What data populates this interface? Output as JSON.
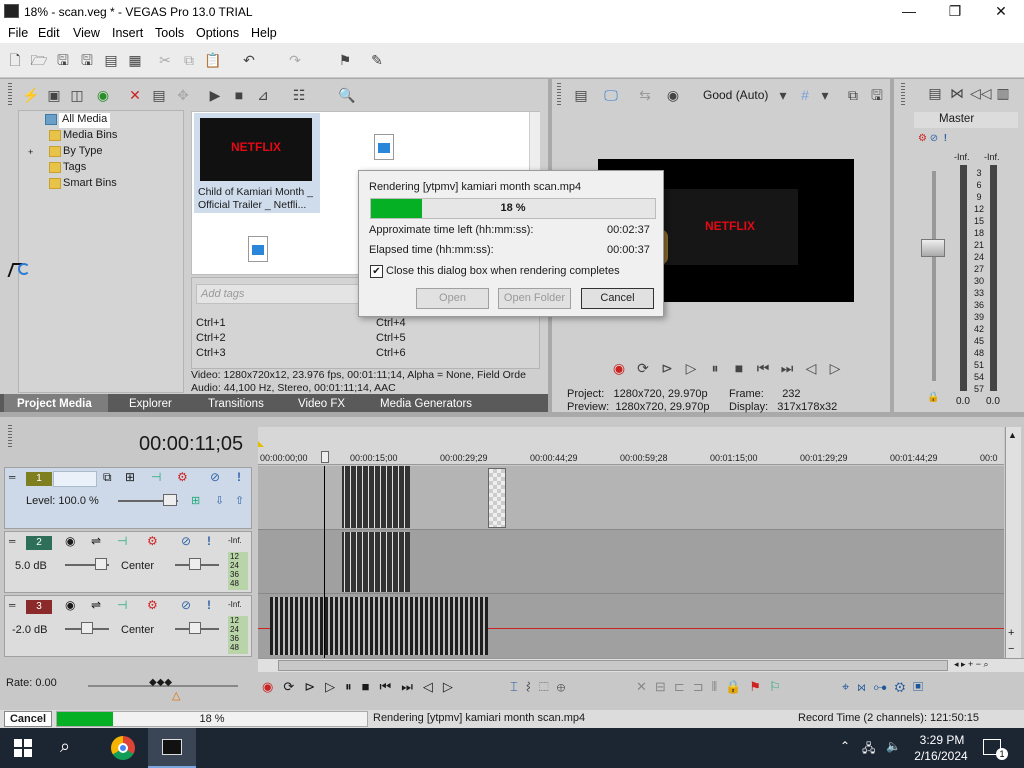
{
  "window": {
    "title": "18% - scan.veg * - VEGAS Pro 13.0 TRIAL",
    "minimize": "—",
    "maximize": "❐",
    "close": "✕"
  },
  "menu": [
    "File",
    "Edit",
    "View",
    "Insert",
    "Tools",
    "Options",
    "Help"
  ],
  "explorer": {
    "tree": [
      "All Media",
      "Media Bins",
      "By Type",
      "Tags",
      "Smart Bins"
    ],
    "expander": "+",
    "media": {
      "thumb_text": "NETFLIX",
      "name_line1": "Child of Kamiari Month _",
      "name_line2": "Official Trailer _ Netfli..."
    },
    "tags_placeholder": "Add tags",
    "shortcuts_left": [
      "Ctrl+1",
      "Ctrl+2",
      "Ctrl+3"
    ],
    "shortcuts_right": [
      "Ctrl+4",
      "Ctrl+5",
      "Ctrl+6"
    ],
    "info_video": "Video: 1280x720x12, 23.976 fps, 00:01:11;14, Alpha = None, Field Orde",
    "info_audio": "Audio: 44,100 Hz, Stereo, 00:01:11;14, AAC",
    "tabs": [
      "Project Media",
      "Explorer",
      "Transitions",
      "Video FX",
      "Media Generators"
    ]
  },
  "preview": {
    "quality": "Good (Auto)",
    "screen_text": "NETFLIX",
    "project_label": "Project:",
    "project_value": "1280x720, 29.970p",
    "preview_label": "Preview:",
    "preview_value": "1280x720, 29.970p",
    "frame_label": "Frame:",
    "frame_value": "232",
    "display_label": "Display:",
    "display_value": "317x178x32"
  },
  "master": {
    "title": "Master",
    "inf_left": "-Inf.",
    "inf_right": "-Inf.",
    "scale": [
      "3",
      "6",
      "9",
      "12",
      "15",
      "18",
      "21",
      "24",
      "27",
      "30",
      "33",
      "36",
      "39",
      "42",
      "45",
      "48",
      "51",
      "54",
      "57"
    ],
    "val_left": "0.0",
    "val_right": "0.0"
  },
  "dialog": {
    "title": "Rendering [ytpmv] kamiari month scan.mp4",
    "progress_label": "18 %",
    "progress_fraction": 0.18,
    "time_left_label": "Approximate time left (hh:mm:ss):",
    "time_left_value": "00:02:37",
    "elapsed_label": "Elapsed time (hh:mm:ss):",
    "elapsed_value": "00:00:37",
    "checkbox_label": "Close this dialog box when rendering completes",
    "checked": "✔",
    "open_btn": "Open",
    "open_folder_btn": "Open Folder",
    "cancel_btn": "Cancel"
  },
  "timeline": {
    "timecode": "00:00:11;05",
    "ruler": [
      "00:00:00;00",
      "00:00:15;00",
      "00:00:29;29",
      "00:00:44;29",
      "00:00:59;28",
      "00:01:15;00",
      "00:01:29;29",
      "00:01:44;29",
      "00:0"
    ],
    "track1": {
      "number": "1",
      "level": "Level: 100.0 %"
    },
    "track2": {
      "number": "2",
      "volume": "5.0 dB",
      "pan": "Center",
      "inf": "-Inf.",
      "meter": [
        "12",
        "24",
        "36",
        "48"
      ]
    },
    "track3": {
      "number": "3",
      "volume": "-2.0 dB",
      "pan": "Center",
      "inf": "-Inf.",
      "meter": [
        "12",
        "24",
        "36",
        "48"
      ]
    },
    "rate": "Rate: 0.00"
  },
  "statusbar": {
    "cancel": "Cancel",
    "progress_label": "18 %",
    "progress_fraction": 0.18,
    "message": "Rendering [ytpmv] kamiari month scan.mp4",
    "record_time": "Record Time (2 channels): 121:50:15"
  },
  "taskbar": {
    "time": "3:29 PM",
    "date": "2/16/2024",
    "notif_count": "1"
  },
  "colors": {
    "progress": "#06b025",
    "accent": "#1e5799",
    "track_blue": "#cdd9e8"
  }
}
